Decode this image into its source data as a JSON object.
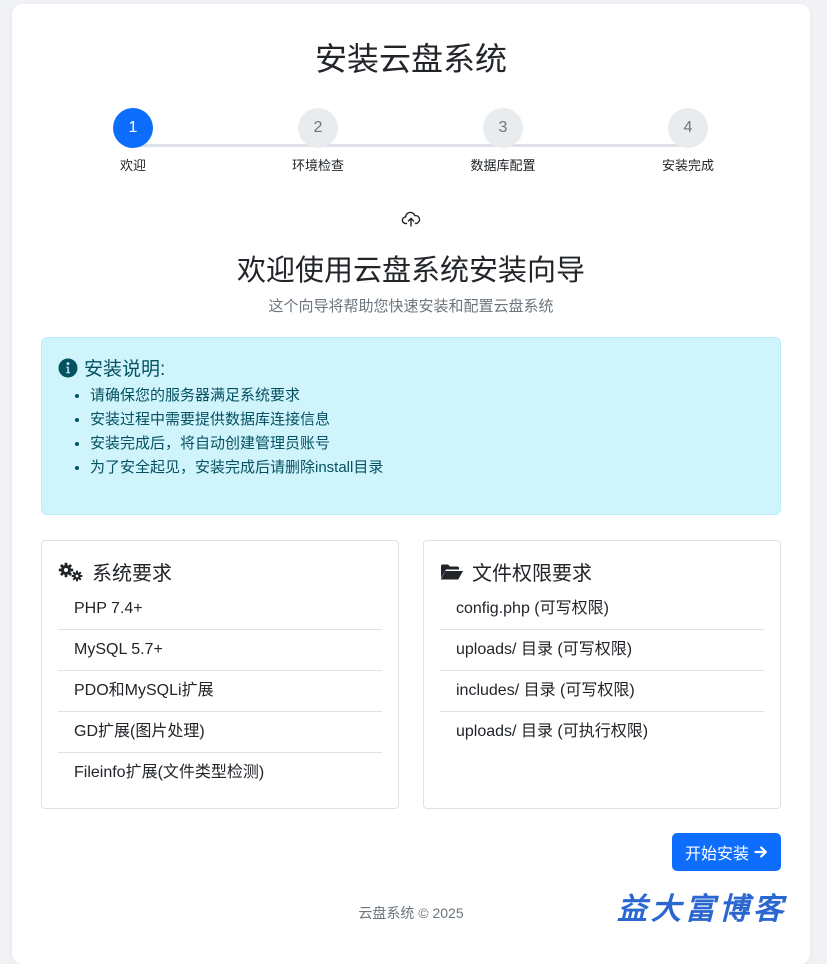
{
  "page": {
    "title": "安装云盘系统"
  },
  "stepper": {
    "steps": [
      {
        "number": "1",
        "label": "欢迎",
        "active": true
      },
      {
        "number": "2",
        "label": "环境检查",
        "active": false
      },
      {
        "number": "3",
        "label": "数据库配置",
        "active": false
      },
      {
        "number": "4",
        "label": "安装完成",
        "active": false
      }
    ]
  },
  "welcome": {
    "icon": "cloud-upload-icon",
    "title": "欢迎使用云盘系统安装向导",
    "subtitle": "这个向导将帮助您快速安装和配置云盘系统"
  },
  "notice": {
    "icon": "info-circle-icon",
    "heading": "安装说明:",
    "items": [
      "请确保您的服务器满足系统要求",
      "安装过程中需要提供数据库连接信息",
      "安装完成后，将自动创建管理员账号",
      "为了安全起见，安装完成后请删除install目录"
    ]
  },
  "system_requirements": {
    "icon": "gears-icon",
    "heading": "系统要求",
    "items": [
      "PHP 7.4+",
      "MySQL 5.7+",
      "PDO和MySQLi扩展",
      "GD扩展(图片处理)",
      "Fileinfo扩展(文件类型检测)"
    ]
  },
  "file_permissions": {
    "icon": "folder-open-icon",
    "heading": "文件权限要求",
    "items": [
      "config.php (可写权限)",
      "uploads/ 目录 (可写权限)",
      "includes/ 目录 (可写权限)",
      "uploads/ 目录 (可执行权限)"
    ]
  },
  "actions": {
    "start_label": "开始安装",
    "start_icon": "arrow-right-icon"
  },
  "footer": {
    "text": "云盘系统 © 2025"
  },
  "watermark": {
    "text": "益大富博客"
  },
  "colors": {
    "primary": "#0d6efd",
    "info_bg": "#cff4fc",
    "info_text": "#055160",
    "muted": "#6c757d"
  }
}
